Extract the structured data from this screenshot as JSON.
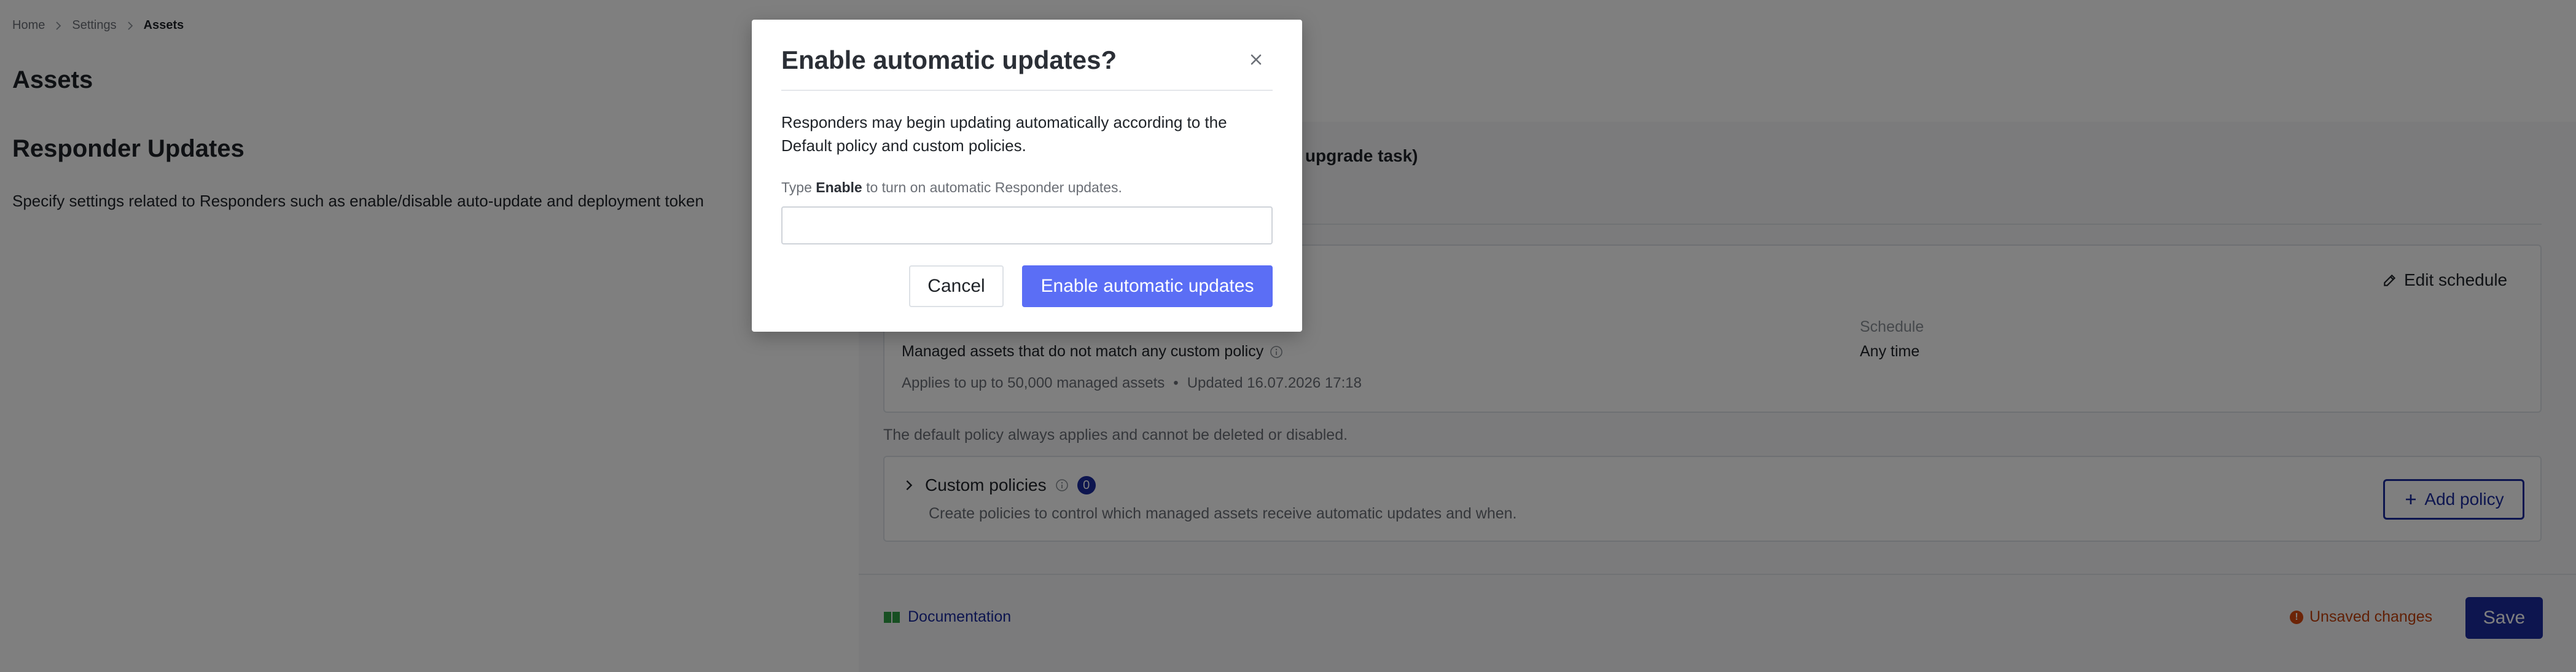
{
  "breadcrumb": {
    "items": [
      "Home",
      "Settings"
    ],
    "current": "Assets"
  },
  "page": {
    "title": "Assets"
  },
  "section": {
    "title": "Responder Updates",
    "description": "Specify settings related to Responders such as enable/disable auto-update and deployment token"
  },
  "panel": {
    "heading_fragment": "n upgrade task)",
    "default_policy": {
      "edit_schedule_label": "Edit schedule",
      "schedule_label": "Schedule",
      "targets": "Managed assets that do not match any custom policy",
      "schedule_value": "Any time",
      "applies_to": "Applies to up to 50,000 managed assets",
      "meta_separator": "•",
      "updated": "Updated 16.07.2026 17:18"
    },
    "default_note": "The default policy always applies and cannot be deleted or disabled.",
    "custom_policies": {
      "title": "Custom policies",
      "count": "0",
      "description": "Create policies to control which managed assets receive automatic updates and when.",
      "add_label": "Add policy"
    }
  },
  "footer": {
    "documentation_label": "Documentation",
    "unsaved_label": "Unsaved changes",
    "unsaved_icon": "!",
    "save_label": "Save"
  },
  "modal": {
    "title": "Enable automatic updates?",
    "body": "Responders may begin updating automatically according to the Default policy and custom policies.",
    "hint_prefix": "Type",
    "hint_keyword": "Enable",
    "hint_suffix": "to turn on automatic Responder updates.",
    "input_value": "",
    "cancel_label": "Cancel",
    "confirm_label": "Enable automatic updates"
  },
  "colors": {
    "primary": "#1b2a9e",
    "modal_confirm": "#5b6ef5",
    "warning": "#c2410c",
    "docs_icon": "#2f9e44"
  },
  "icons": [
    "chevron-right-icon",
    "close-icon",
    "edit-icon",
    "info-icon",
    "plus-icon",
    "book-icon",
    "warning-icon"
  ]
}
